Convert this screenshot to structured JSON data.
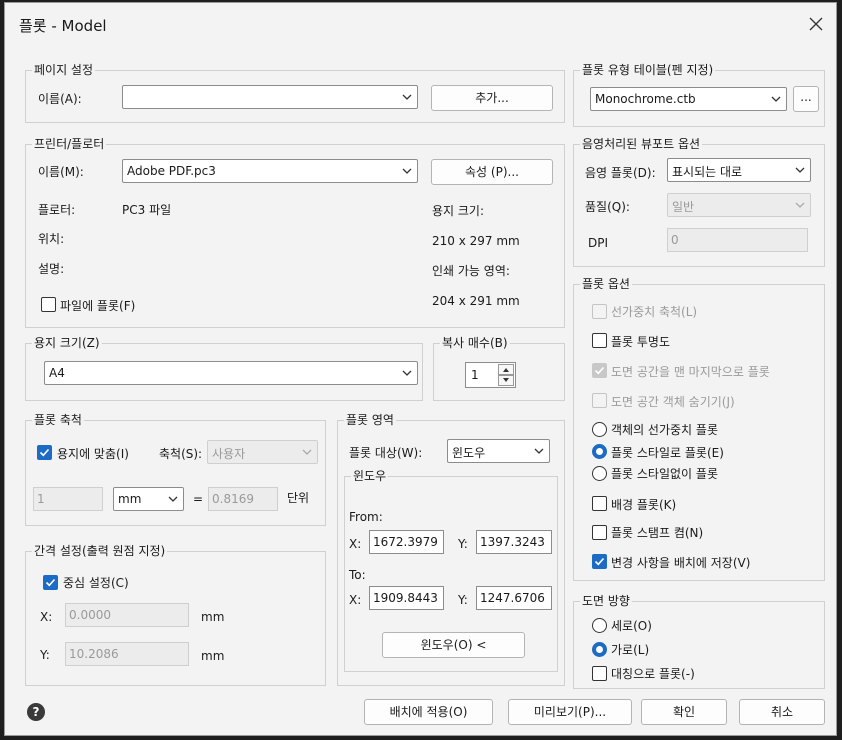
{
  "window": {
    "title": "플롯 - Model"
  },
  "page_setup": {
    "title": "페이지 설정",
    "name_label": "이름(A):",
    "name_value": "",
    "add_button": "추가..."
  },
  "printer": {
    "title": "프린터/플로터",
    "name_label": "이름(M):",
    "name_value": "Adobe PDF.pc3",
    "properties_button": "속성 (P)...",
    "plotter_label": "플로터:",
    "plotter_value": "PC3 파일",
    "location_label": "위치:",
    "description_label": "설명:",
    "paper_size_label": "용지 크기:",
    "paper_size_value": "210 x 297 mm",
    "printable_area_label": "인쇄 가능 영역:",
    "printable_area_value": "204 x 291 mm",
    "plot_to_file_label": "파일에 플롯(F)",
    "plot_to_file_checked": false
  },
  "paper_size": {
    "title": "용지 크기(Z)",
    "value": "A4"
  },
  "copies": {
    "title": "복사 매수(B)",
    "value": "1"
  },
  "plot_area": {
    "title": "플롯 영역",
    "what_label": "플롯 대상(W):",
    "what_value": "윈도우",
    "window_group_title": "윈도우",
    "from_label": "From:",
    "to_label": "To:",
    "x_label": "X:",
    "y_label": "Y:",
    "from_x": "1672.3979",
    "from_y": "1397.3243",
    "to_x": "1909.8443",
    "to_y": "1247.6706",
    "window_button": "윈도우(O) <"
  },
  "plot_scale": {
    "title": "플롯 축척",
    "fit_label": "용지에 맞춤(I)",
    "fit_checked": true,
    "scale_label": "축척(S):",
    "scale_value": "사용자",
    "value1": "1",
    "unit": "mm",
    "equals": "=",
    "value2": "0.8169",
    "units_label": "단위"
  },
  "plot_offset": {
    "title": "간격 설정(출력 원점 지정)",
    "center_label": "중심 설정(C)",
    "center_checked": true,
    "x_label": "X:",
    "x_value": "0.0000",
    "y_label": "Y:",
    "y_value": "10.2086",
    "unit": "mm"
  },
  "plot_style_table": {
    "title": "플롯 유형 테이블(펜 지정)",
    "value": "Monochrome.ctb",
    "edit_button": "..."
  },
  "shaded_viewport": {
    "title": "음영처리된 뷰포트 옵션",
    "shade_label": "음영 플롯(D):",
    "shade_value": "표시되는 대로",
    "quality_label": "품질(Q):",
    "quality_value": "일반",
    "dpi_label": "DPI",
    "dpi_value": "0"
  },
  "plot_options": {
    "title": "플롯 옵션",
    "items": [
      {
        "label": "선가중치 축척(L)",
        "checked": false,
        "disabled": true
      },
      {
        "label": "플롯 투명도",
        "checked": false,
        "disabled": false
      },
      {
        "label": "도면 공간을 맨 마지막으로 플롯",
        "checked": true,
        "disabled": true
      },
      {
        "label": "도면 공간 객체 숨기기(J)",
        "checked": false,
        "disabled": true
      },
      {
        "label": "객체의 선가중치 플롯",
        "checked": false,
        "disabled": false
      },
      {
        "label": "플롯 스타일로 플롯(E)",
        "checked": true,
        "disabled": false
      },
      {
        "label": "플롯 스타일없이 플롯",
        "checked": false,
        "disabled": false
      },
      {
        "label": "배경 플롯(K)",
        "checked": false,
        "disabled": false
      },
      {
        "label": "플롯 스탬프 켬(N)",
        "checked": false,
        "disabled": false
      },
      {
        "label": "변경 사항을 배치에 저장(V)",
        "checked": true,
        "disabled": false
      }
    ]
  },
  "orientation": {
    "title": "도면 방향",
    "portrait": "세로(O)",
    "landscape": "가로(L)",
    "upside_down": "대칭으로 플롯(-)",
    "selected": "landscape"
  },
  "footer": {
    "help_glyph": "?",
    "apply_button": "배치에 적용(O)",
    "preview_button": "미리보기(P)...",
    "ok_button": "확인",
    "cancel_button": "취소"
  },
  "colors": {
    "accent": "#1c6bc4",
    "dialog_bg": "#f3f3f3",
    "disabled_text": "#9a9a9a"
  }
}
